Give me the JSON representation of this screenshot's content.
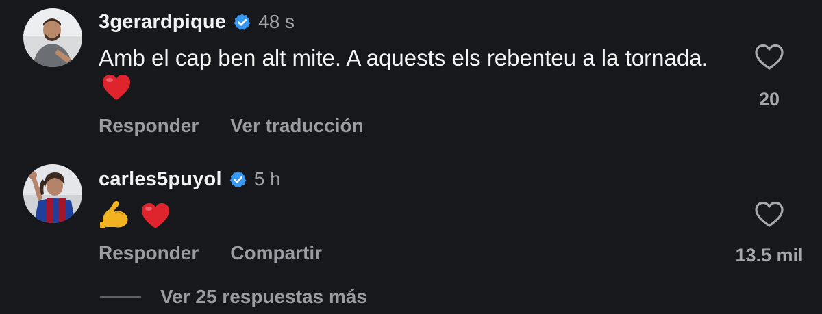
{
  "comments": [
    {
      "username": "3gerardpique",
      "timestamp": "48 s",
      "text": "Amb el cap ben alt mite. A aquests els rebenteu a la tornada.",
      "emojis": [
        "red-heart"
      ],
      "like_count": "20",
      "actions": [
        "Responder",
        "Ver traducción"
      ]
    },
    {
      "username": "carles5puyol",
      "timestamp": "5 h",
      "text": "",
      "emojis": [
        "flexed-biceps",
        "red-heart"
      ],
      "like_count": "13.5 mil",
      "actions": [
        "Responder",
        "Compartir"
      ]
    }
  ],
  "replies_link": "Ver 25 respuestas más",
  "colors": {
    "background": "#17181c",
    "verified_badge": "#3897f0",
    "muted_text": "#9a9ca2"
  }
}
